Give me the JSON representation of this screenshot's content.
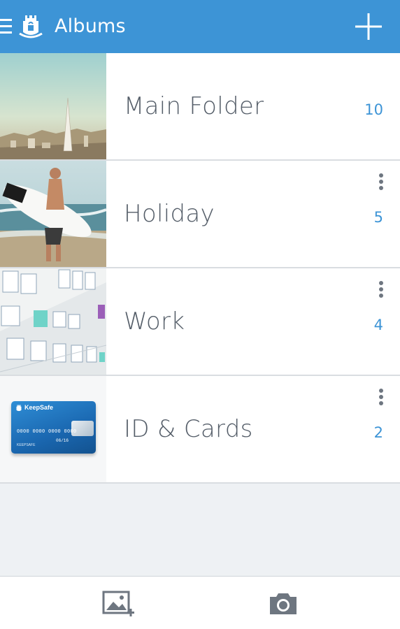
{
  "header": {
    "title": "Albums",
    "menu_icon": "hamburger-menu-icon",
    "logo_icon": "keepsafe-logo-icon",
    "add_icon": "plus-icon"
  },
  "albums": [
    {
      "name": "Main Folder",
      "count": "10",
      "thumbnail": "city skyline photo",
      "has_menu": false
    },
    {
      "name": "Holiday",
      "count": "5",
      "thumbnail": "surfer on beach photo",
      "has_menu": true
    },
    {
      "name": "Work",
      "count": "4",
      "thumbnail": "whiteboard with notes photo",
      "has_menu": true
    },
    {
      "name": "ID & Cards",
      "count": "2",
      "thumbnail": "keepsafe card",
      "has_menu": true
    }
  ],
  "card": {
    "brand": "KeepSafe",
    "number": "0000 0000 0000 0000",
    "name": "KEEPSAFE",
    "expiry": "06/16"
  },
  "bottom_bar": {
    "import_icon": "add-photo-icon",
    "camera_icon": "camera-icon"
  },
  "colors": {
    "accent": "#3d94d6",
    "text": "#545d68",
    "background": "#eef1f4"
  }
}
